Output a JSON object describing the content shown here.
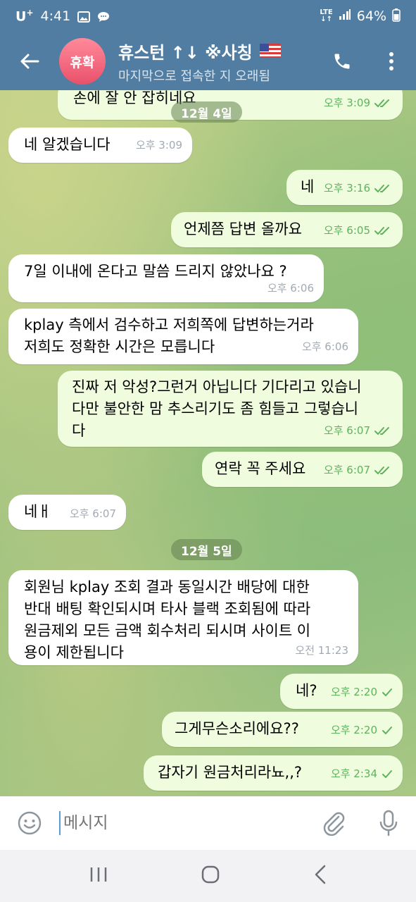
{
  "status": {
    "carrier": "U",
    "carrier_sup": "+",
    "time": "4:41",
    "network": "LTE",
    "battery": "64%"
  },
  "header": {
    "avatar_text": "휴확",
    "title": "휴스턴 ↑↓ ※사칭",
    "subtitle": "마지막으로 접속한 지 오래됨"
  },
  "dates": {
    "d1": "12월 4일",
    "d2": "12월 5일"
  },
  "messages": [
    {
      "text": "손에 잘 안 잡히네요",
      "time": "오후 3:09"
    },
    {
      "text": "네 알겠습니다",
      "time": "오후 3:09"
    },
    {
      "text": "네",
      "time": "오후 3:16"
    },
    {
      "text": "언제쯤 답변 올까요",
      "time": "오후 6:05"
    },
    {
      "text": "7일 이내에 온다고 말씀 드리지 않았나요 ?",
      "time": "오후 6:06"
    },
    {
      "text": "kplay 측에서 검수하고 저희쪽에 답변하는거라\n저희도 정확한 시간은 모릅니다",
      "time": "오후 6:06"
    },
    {
      "text": "진짜 저 악성?그런거 아닙니다 기다리고 있습니\n다만 불안한 맘 추스리기도 좀 힘들고 그렇습니\n다",
      "time": "오후 6:07"
    },
    {
      "text": "연락 꼭 주세요",
      "time": "오후 6:07"
    },
    {
      "text": "네ㅐ",
      "time": "오후 6:07"
    },
    {
      "text": "회원님 kplay 조회 결과 동일시간 배당에 대한\n반대 배팅 확인되시며 타사 블랙 조회됨에 따라\n원금제외 모든 금액 회수처리 되시며 사이트 이\n용이 제한됩니다",
      "time": "오전 11:23"
    },
    {
      "text": "네?",
      "time": "오후 2:20"
    },
    {
      "text": "그게무슨소리에요??",
      "time": "오후 2:20"
    },
    {
      "text": "갑자기 원금처리라뇨,,?",
      "time": "오후 2:34"
    }
  ],
  "composer": {
    "placeholder": "메시지"
  },
  "colors": {
    "header": "#517da2",
    "outgoing": "#effdde",
    "incoming": "#ffffff",
    "check": "#5fb25d"
  }
}
